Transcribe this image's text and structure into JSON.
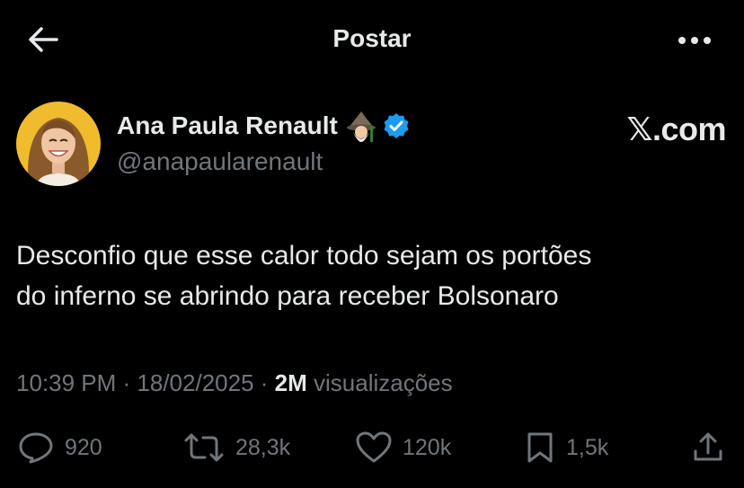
{
  "header": {
    "title": "Postar",
    "back_icon": "arrow-left-icon",
    "more_icon": "more-horizontal-icon"
  },
  "author": {
    "name": "Ana Paula Renault",
    "handle": "@anapaularenault",
    "name_emoji": "mage-emoji-icon",
    "verified": true,
    "avatar_icon": "profile-photo"
  },
  "brand": "𝕏.com",
  "tweet": {
    "text_line1": "Desconfio que esse calor todo sejam os portões",
    "text_line2": "do inferno se abrindo para receber Bolsonaro",
    "time": "10:39 PM",
    "sep1": " · ",
    "date": "18/02/2025",
    "sep2": " · ",
    "views_count": "2M",
    "views_label": " visualizações"
  },
  "actions": {
    "replies": "920",
    "reposts": "28,3k",
    "likes": "120k",
    "bookmarks": "1,5k"
  },
  "colors": {
    "background": "#000000",
    "text": "#e7e9ea",
    "secondary": "#71767b",
    "verified": "#1d9bf0"
  }
}
